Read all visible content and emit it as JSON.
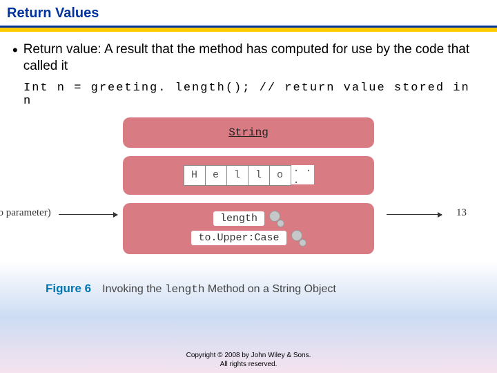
{
  "title": "Return Values",
  "bullet": "Return value: A result that the method has computed for use by the code that called it",
  "code": "Int n = greeting. length(); // return value stored in n",
  "diagram": {
    "type_label": "String",
    "chars": [
      "H",
      "e",
      "l",
      "l",
      "o"
    ],
    "more": ". . .",
    "no_param": "(no parameter)",
    "method1": "length",
    "method2": "to.Upper:Case",
    "result": "13"
  },
  "caption": {
    "fig": "Figure 6",
    "text_pre": "Invoking the ",
    "text_mid": "length",
    "text_aft": " Method on a String Object"
  },
  "copyright": {
    "line1": "Copyright © 2008 by John Wiley & Sons.",
    "line2": "All rights reserved."
  }
}
